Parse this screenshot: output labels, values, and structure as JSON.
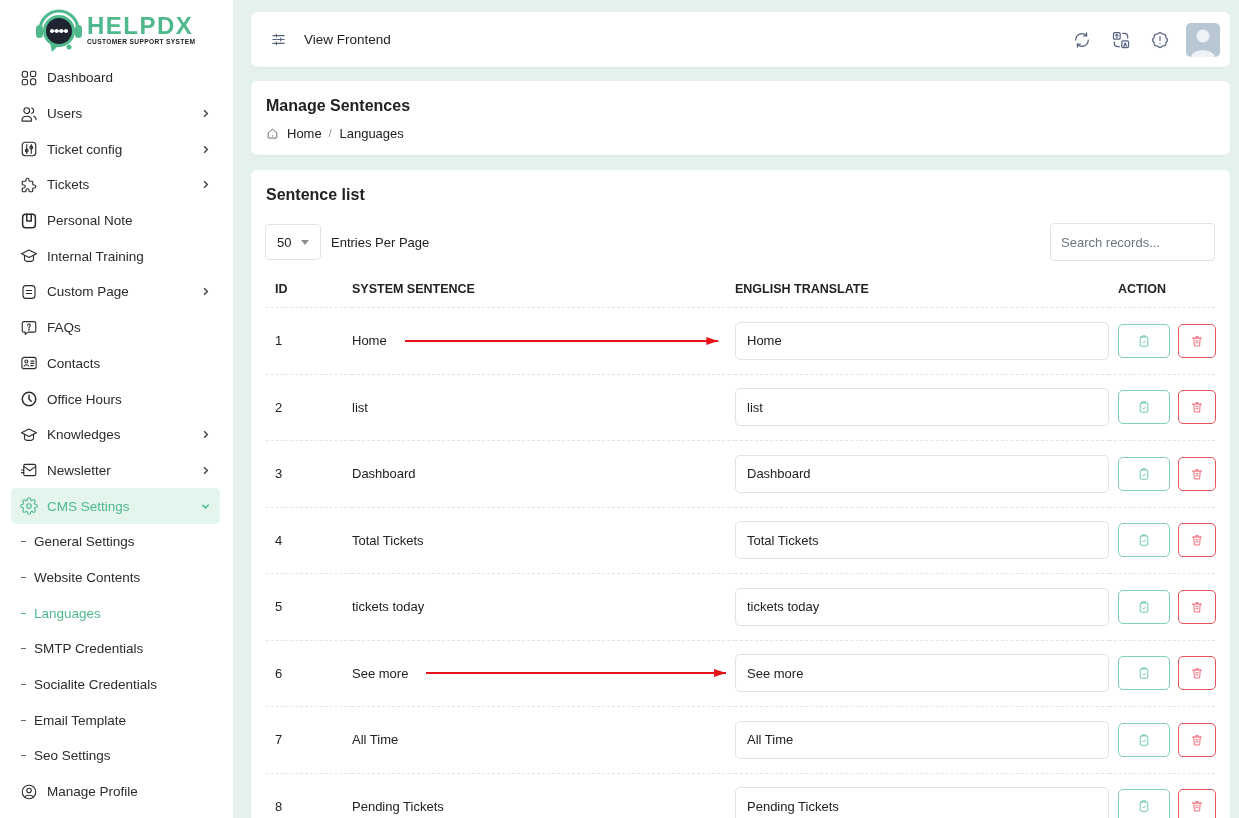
{
  "sidebar": {
    "logo": {
      "name": "HELPDX",
      "tagline": "CUSTOMER SUPPORT SYSTEM"
    },
    "items": [
      {
        "label": "Dashboard",
        "has_submenu": false,
        "expanded": false,
        "selected": false
      },
      {
        "label": "Users",
        "has_submenu": true,
        "expanded": false,
        "selected": false
      },
      {
        "label": "Ticket config",
        "has_submenu": true,
        "expanded": false,
        "selected": false
      },
      {
        "label": "Tickets",
        "has_submenu": true,
        "expanded": false,
        "selected": false
      },
      {
        "label": "Personal Note",
        "has_submenu": false,
        "expanded": false,
        "selected": false
      },
      {
        "label": "Internal Training",
        "has_submenu": false,
        "expanded": false,
        "selected": false
      },
      {
        "label": "Custom Page",
        "has_submenu": true,
        "expanded": false,
        "selected": false
      },
      {
        "label": "FAQs",
        "has_submenu": false,
        "expanded": false,
        "selected": false
      },
      {
        "label": "Contacts",
        "has_submenu": false,
        "expanded": false,
        "selected": false
      },
      {
        "label": "Office Hours",
        "has_submenu": false,
        "expanded": false,
        "selected": false
      },
      {
        "label": "Knowledges",
        "has_submenu": true,
        "expanded": false,
        "selected": false
      },
      {
        "label": "Newsletter",
        "has_submenu": true,
        "expanded": false,
        "selected": false
      },
      {
        "label": "CMS Settings",
        "has_submenu": true,
        "expanded": true,
        "selected": true,
        "children": [
          {
            "label": "General Settings",
            "selected": false
          },
          {
            "label": "Website Contents",
            "selected": false
          },
          {
            "label": "Languages",
            "selected": true
          },
          {
            "label": "SMTP Credentials",
            "selected": false
          },
          {
            "label": "Socialite Credentials",
            "selected": false
          },
          {
            "label": "Email Template",
            "selected": false
          },
          {
            "label": "Seo Settings",
            "selected": false
          }
        ]
      },
      {
        "label": "Manage Profile",
        "has_submenu": false,
        "expanded": false,
        "selected": false
      }
    ]
  },
  "topbar": {
    "link": "View Frontend"
  },
  "page_header": {
    "title": "Manage Sentences",
    "separator": "/",
    "breadcrumb": [
      "Home",
      "Languages"
    ]
  },
  "sentence_list": {
    "title": "Sentence list",
    "page_size": "50",
    "page_size_label": "Entries Per Page",
    "search_placeholder": "Search records...",
    "columns": [
      "ID",
      "SYSTEM SENTENCE",
      "ENGLISH TRANSLATE",
      "ACTION"
    ],
    "rows": [
      {
        "id": "1",
        "sentence": "Home",
        "translation": "Home",
        "arrow": true
      },
      {
        "id": "2",
        "sentence": "list",
        "translation": "list",
        "arrow": false
      },
      {
        "id": "3",
        "sentence": "Dashboard",
        "translation": "Dashboard",
        "arrow": false
      },
      {
        "id": "4",
        "sentence": "Total Tickets",
        "translation": "Total Tickets",
        "arrow": false
      },
      {
        "id": "5",
        "sentence": "tickets today",
        "translation": "tickets today",
        "arrow": false
      },
      {
        "id": "6",
        "sentence": "See more",
        "translation": "See more",
        "arrow": true
      },
      {
        "id": "7",
        "sentence": "All Time",
        "translation": "All Time",
        "arrow": false
      },
      {
        "id": "8",
        "sentence": "Pending Tickets",
        "translation": "Pending Tickets",
        "arrow": false
      }
    ]
  }
}
